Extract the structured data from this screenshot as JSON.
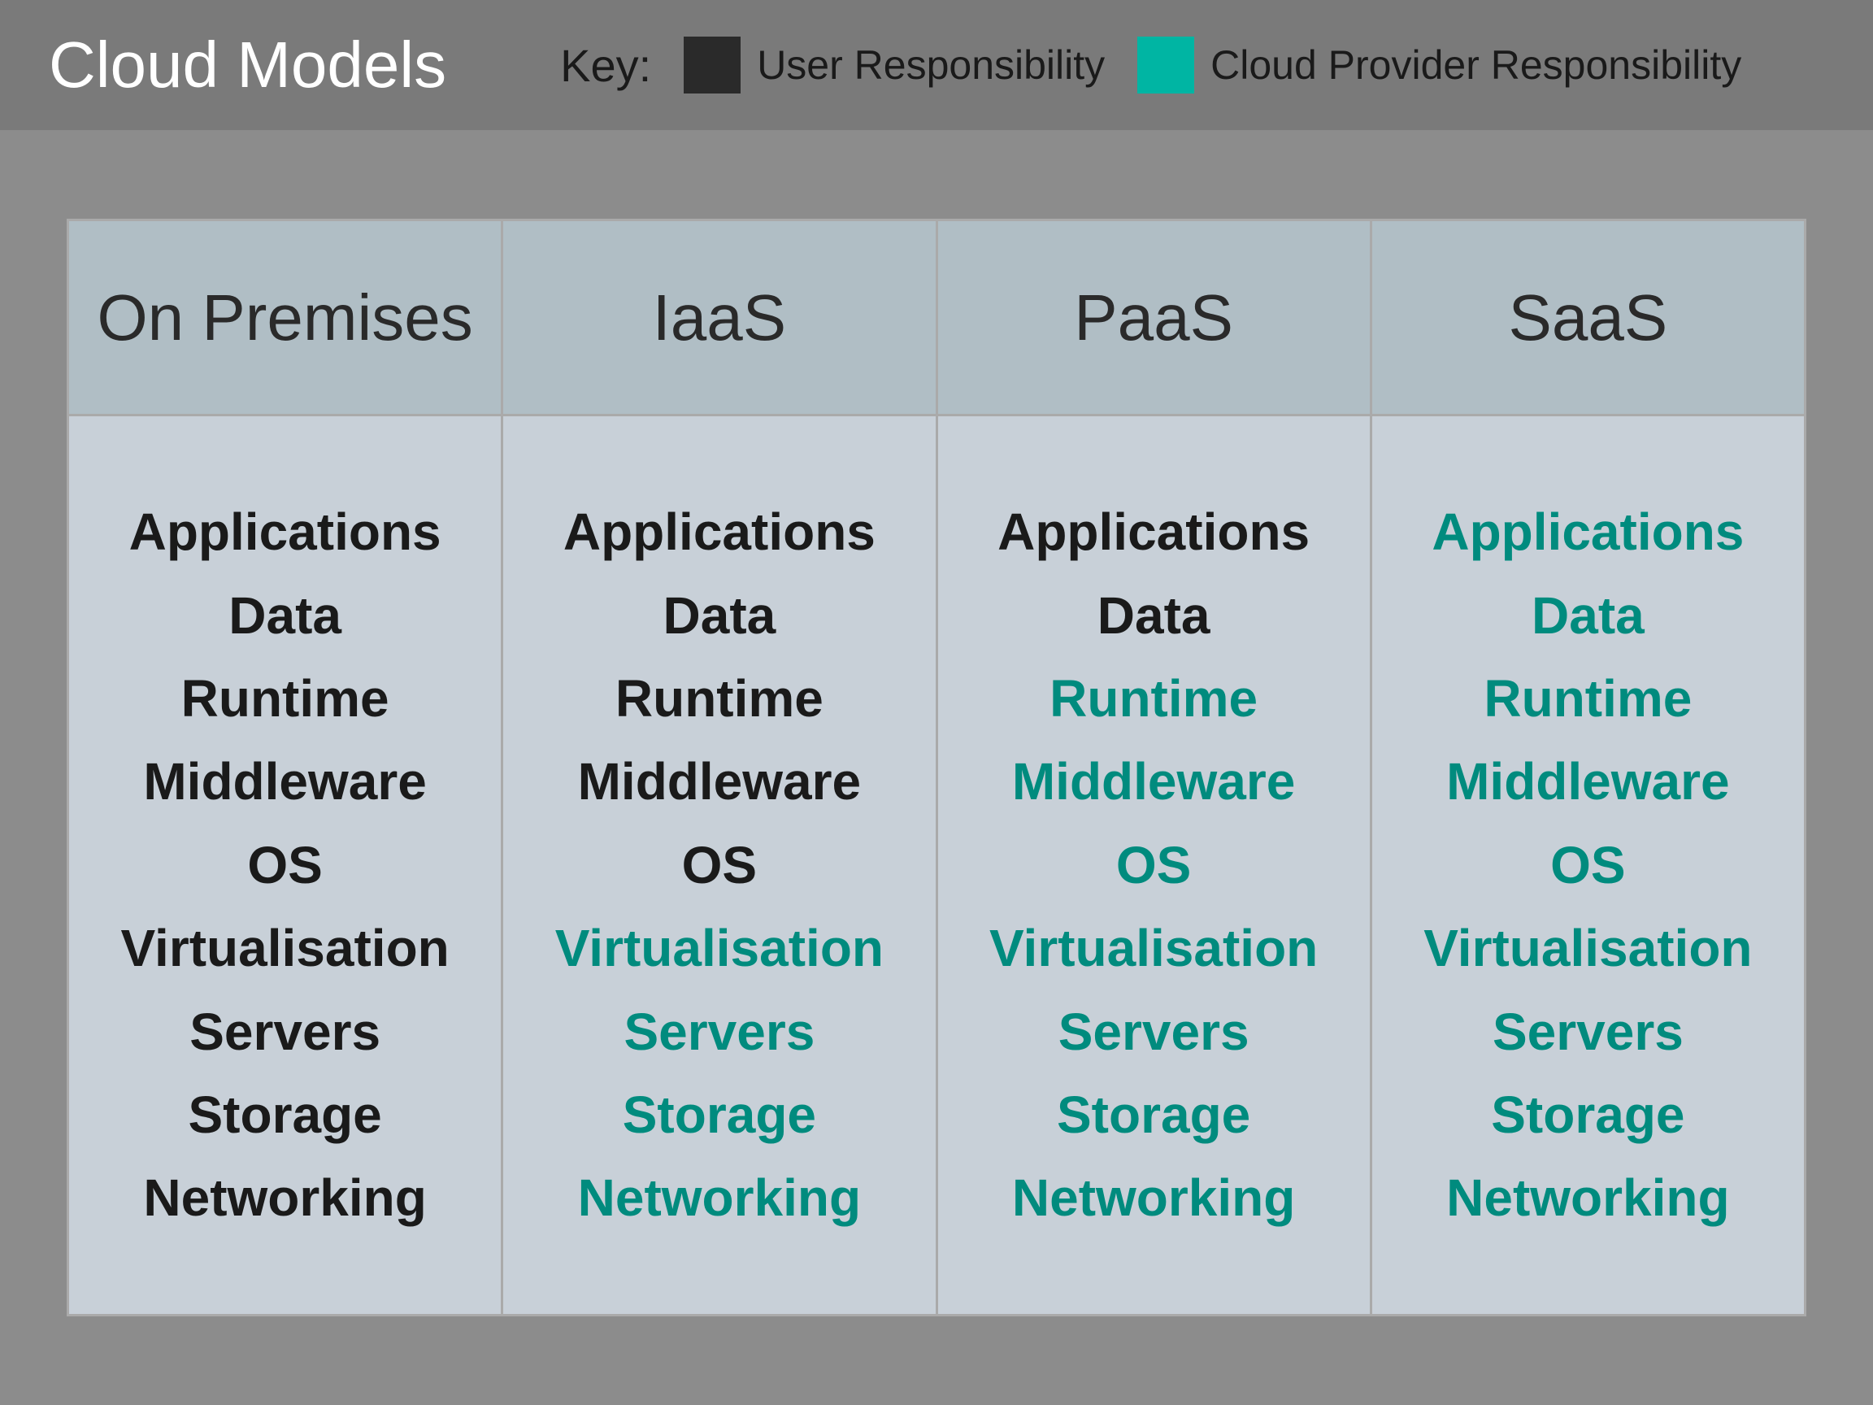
{
  "header": {
    "title": "Cloud Models",
    "key_label": "Key:",
    "user_responsibility_label": "User Responsibility",
    "provider_responsibility_label": "Cloud Provider Responsibility"
  },
  "columns": [
    {
      "id": "on-premises",
      "header": "On Premises",
      "items": [
        {
          "label": "Applications",
          "type": "user"
        },
        {
          "label": "Data",
          "type": "user"
        },
        {
          "label": "Runtime",
          "type": "user"
        },
        {
          "label": "Middleware",
          "type": "user"
        },
        {
          "label": "OS",
          "type": "user"
        },
        {
          "label": "Virtualisation",
          "type": "user"
        },
        {
          "label": "Servers",
          "type": "user"
        },
        {
          "label": "Storage",
          "type": "user"
        },
        {
          "label": "Networking",
          "type": "user"
        }
      ]
    },
    {
      "id": "iaas",
      "header": "IaaS",
      "items": [
        {
          "label": "Applications",
          "type": "user"
        },
        {
          "label": "Data",
          "type": "user"
        },
        {
          "label": "Runtime",
          "type": "user"
        },
        {
          "label": "Middleware",
          "type": "user"
        },
        {
          "label": "OS",
          "type": "user"
        },
        {
          "label": "Virtualisation",
          "type": "provider"
        },
        {
          "label": "Servers",
          "type": "provider"
        },
        {
          "label": "Storage",
          "type": "provider"
        },
        {
          "label": "Networking",
          "type": "provider"
        }
      ]
    },
    {
      "id": "paas",
      "header": "PaaS",
      "items": [
        {
          "label": "Applications",
          "type": "user"
        },
        {
          "label": "Data",
          "type": "user"
        },
        {
          "label": "Runtime",
          "type": "provider"
        },
        {
          "label": "Middleware",
          "type": "provider"
        },
        {
          "label": "OS",
          "type": "provider"
        },
        {
          "label": "Virtualisation",
          "type": "provider"
        },
        {
          "label": "Servers",
          "type": "provider"
        },
        {
          "label": "Storage",
          "type": "provider"
        },
        {
          "label": "Networking",
          "type": "provider"
        }
      ]
    },
    {
      "id": "saas",
      "header": "SaaS",
      "items": [
        {
          "label": "Applications",
          "type": "provider"
        },
        {
          "label": "Data",
          "type": "provider"
        },
        {
          "label": "Runtime",
          "type": "provider"
        },
        {
          "label": "Middleware",
          "type": "provider"
        },
        {
          "label": "OS",
          "type": "provider"
        },
        {
          "label": "Virtualisation",
          "type": "provider"
        },
        {
          "label": "Servers",
          "type": "provider"
        },
        {
          "label": "Storage",
          "type": "provider"
        },
        {
          "label": "Networking",
          "type": "provider"
        }
      ]
    }
  ]
}
